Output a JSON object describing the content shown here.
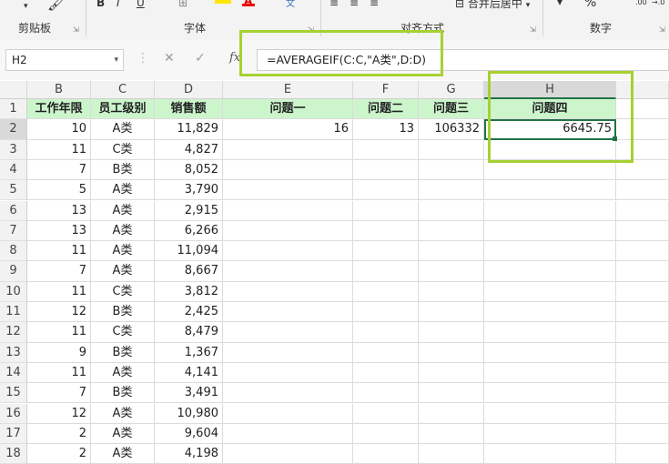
{
  "ribbon": {
    "groups": [
      {
        "label": "剪贴板"
      },
      {
        "label": "字体"
      },
      {
        "label": "对齐方式"
      },
      {
        "label": "数字"
      }
    ],
    "merge_label": "合并后居中",
    "percent_symbol": "%"
  },
  "formula_bar": {
    "name_box": "H2",
    "fx_label": "fx",
    "formula": "=AVERAGEIF(C:C,\"A类\",D:D)"
  },
  "columns": [
    "B",
    "C",
    "D",
    "E",
    "F",
    "G",
    "H"
  ],
  "header_row": {
    "row": "1",
    "B": "工作年限",
    "C": "员工级别",
    "D": "销售额",
    "E": "问题一",
    "F": "问题二",
    "G": "问题三",
    "H": "问题四"
  },
  "rows": [
    {
      "row": "2",
      "B": "10",
      "C": "A类",
      "D": "11,829",
      "E": "16",
      "F": "13",
      "G": "106332",
      "H": "6645.75"
    },
    {
      "row": "3",
      "B": "11",
      "C": "C类",
      "D": "4,827"
    },
    {
      "row": "4",
      "B": "7",
      "C": "B类",
      "D": "8,052"
    },
    {
      "row": "5",
      "B": "5",
      "C": "A类",
      "D": "3,790"
    },
    {
      "row": "6",
      "B": "13",
      "C": "A类",
      "D": "2,915"
    },
    {
      "row": "7",
      "B": "13",
      "C": "A类",
      "D": "6,266"
    },
    {
      "row": "8",
      "B": "11",
      "C": "A类",
      "D": "11,094"
    },
    {
      "row": "9",
      "B": "7",
      "C": "A类",
      "D": "8,667"
    },
    {
      "row": "10",
      "B": "11",
      "C": "C类",
      "D": "3,812"
    },
    {
      "row": "11",
      "B": "12",
      "C": "B类",
      "D": "2,425"
    },
    {
      "row": "12",
      "B": "11",
      "C": "C类",
      "D": "8,479"
    },
    {
      "row": "13",
      "B": "9",
      "C": "B类",
      "D": "1,367"
    },
    {
      "row": "14",
      "B": "11",
      "C": "A类",
      "D": "4,141"
    },
    {
      "row": "15",
      "B": "7",
      "C": "B类",
      "D": "3,491"
    },
    {
      "row": "16",
      "B": "12",
      "C": "A类",
      "D": "10,980"
    },
    {
      "row": "17",
      "B": "2",
      "C": "A类",
      "D": "9,604"
    },
    {
      "row": "18",
      "B": "2",
      "C": "A类",
      "D": "4,198"
    }
  ],
  "colors": {
    "header_fill": "#ccf5cc",
    "highlight": "#a6d130",
    "selection": "#217346"
  }
}
